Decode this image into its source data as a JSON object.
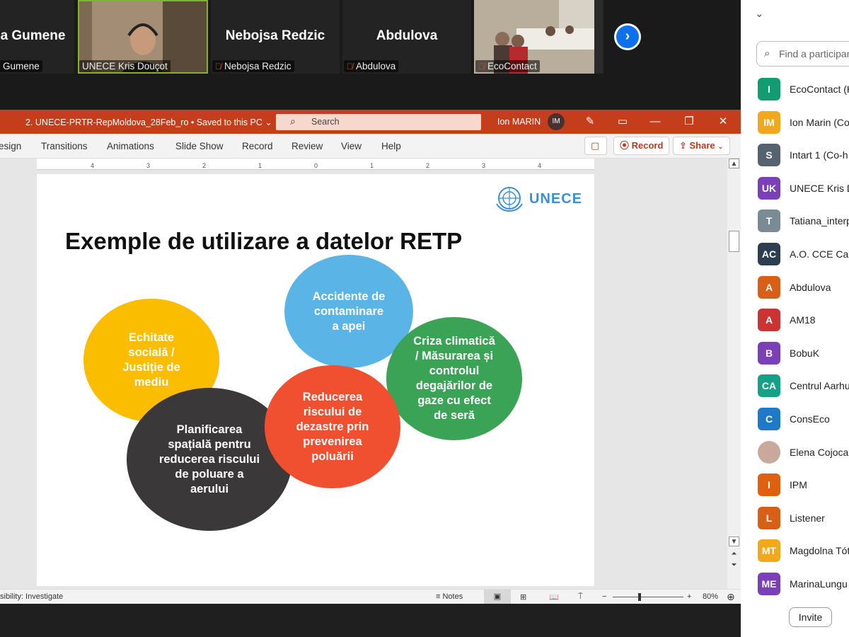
{
  "video_strip": {
    "tiles": [
      {
        "name": "a Gumene",
        "label": "Gumene",
        "muted": false
      },
      {
        "name": "",
        "label": "UNECE Kris Douçot",
        "muted": false
      },
      {
        "name": "Nebojsa Redzic",
        "label": "Nebojsa Redzic",
        "muted": true
      },
      {
        "name": "Abdulova",
        "label": "Abdulova",
        "muted": true
      },
      {
        "name": "",
        "label": "EcoContact",
        "muted": true
      }
    ],
    "next_icon": "chevron-right-icon"
  },
  "powerpoint": {
    "doc_title": "2. UNECE-PRTR-RepMoldova_28Feb_ro • Saved to this PC ⌄",
    "search_placeholder": "Search",
    "user_name": "Ion MARIN",
    "user_initials": "IM",
    "tabs": [
      "esign",
      "Transitions",
      "Animations",
      "Slide Show",
      "Record",
      "Review",
      "View",
      "Help"
    ],
    "record_label": "Record",
    "share_label": "Share",
    "ruler_ticks": [
      "4",
      "3",
      "2",
      "1",
      "0",
      "1",
      "2",
      "3",
      "4"
    ],
    "status_left": "sibility: Investigate",
    "notes_label": "Notes",
    "zoom": "80%",
    "zoom_minus": "−",
    "zoom_plus": "+"
  },
  "slide": {
    "logo_text": "UNECE",
    "title": "Exemple de utilizare a datelor RETP",
    "bubbles": [
      {
        "lines": [
          "Accidente de",
          "contaminare",
          "a apei"
        ],
        "color": "#5ab4e5"
      },
      {
        "lines": [
          "Echitate",
          "socială /",
          "Justiție de",
          "mediu"
        ],
        "color": "#fbbd00"
      },
      {
        "lines": [
          "Criza climatică",
          "/ Măsurarea și",
          "controlul",
          "degajărilor de",
          "gaze cu efect",
          "de seră"
        ],
        "color": "#3aa356"
      },
      {
        "lines": [
          "Planificarea",
          "spațială pentru",
          "reducerea riscului",
          "de poluare a",
          "aerului"
        ],
        "color": "#3a3839"
      },
      {
        "lines": [
          "Reducerea",
          "riscului de",
          "dezastre prin",
          "prevenirea",
          "poluării"
        ],
        "color": "#f0502f"
      }
    ]
  },
  "participants": {
    "search_placeholder": "Find a participant",
    "list": [
      {
        "initials": "I",
        "name": "EcoContact (H",
        "color": "#129c72"
      },
      {
        "initials": "IM",
        "name": "Ion Marin (Co",
        "color": "#f2a81d"
      },
      {
        "initials": "S",
        "name": "Intart 1 (Co-h",
        "color": "#556270"
      },
      {
        "initials": "UK",
        "name": "UNECE Kris D",
        "color": "#7b3fb8"
      },
      {
        "initials": "T",
        "name": "Tatiana_interp",
        "color": "#7a8b95"
      },
      {
        "initials": "AC",
        "name": "A.O. CCE Cah",
        "color": "#2c3e50"
      },
      {
        "initials": "A",
        "name": "Abdulova",
        "color": "#d95f16"
      },
      {
        "initials": "A",
        "name": "AM18",
        "color": "#cc3333"
      },
      {
        "initials": "B",
        "name": "BobuK",
        "color": "#7b3fb8"
      },
      {
        "initials": "CA",
        "name": "Centrul Aarhu",
        "color": "#15a088"
      },
      {
        "initials": "C",
        "name": "ConsEco",
        "color": "#1e7ac8"
      },
      {
        "initials": "",
        "name": "Elena Cojocar",
        "color": "#c9a99b"
      },
      {
        "initials": "I",
        "name": "IPM",
        "color": "#e06010"
      },
      {
        "initials": "L",
        "name": "Listener",
        "color": "#d95f16"
      },
      {
        "initials": "MT",
        "name": "Magdolna Tót",
        "color": "#f2a81d"
      },
      {
        "initials": "ME",
        "name": "MarinaLungu",
        "color": "#7b3fb8"
      }
    ],
    "invite_label": "Invite"
  }
}
